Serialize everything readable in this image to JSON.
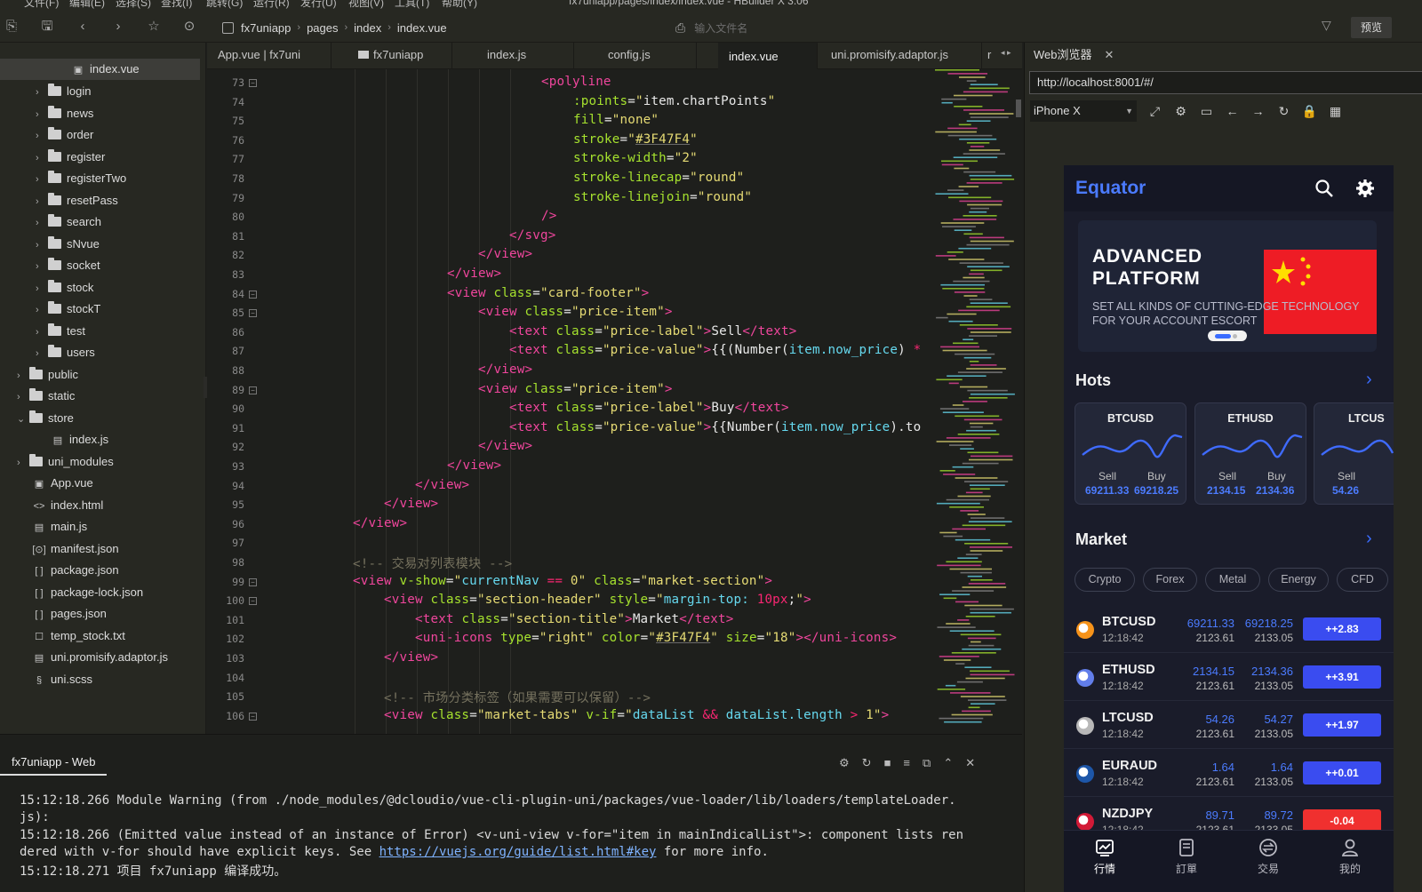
{
  "menu": [
    "文件(F)",
    "编辑(E)",
    "选择(S)",
    "查找(I)",
    "跳转(G)",
    "运行(R)",
    "发行(U)",
    "视图(V)",
    "工具(T)",
    "帮助(Y)"
  ],
  "window_title": "fx7uniapp/pages/index/index.vue - HBuilder X 3.06",
  "breadcrumb": [
    "fx7uniapp",
    "pages",
    "index",
    "index.vue"
  ],
  "file_search_placeholder": "输入文件名",
  "preview_label": "预览",
  "tree": {
    "selected": "index.vue",
    "items": [
      "login",
      "news",
      "order",
      "register",
      "registerTwo",
      "resetPass",
      "search",
      "sNvue",
      "socket",
      "stock",
      "stockT",
      "test",
      "users",
      "public",
      "static",
      "store",
      "index.js",
      "uni_modules",
      "App.vue",
      "index.html",
      "main.js",
      "manifest.json",
      "package.json",
      "package-lock.json",
      "pages.json",
      "temp_stock.txt",
      "uni.promisify.adaptor.js",
      "uni.scss"
    ]
  },
  "editor_tabs": [
    "App.vue | fx7uni",
    "fx7uniapp",
    "index.js",
    "config.js",
    "index.vue",
    "uni.promisify.adaptor.js",
    "r"
  ],
  "line_numbers": [
    "73",
    "74",
    "75",
    "76",
    "77",
    "78",
    "79",
    "80",
    "81",
    "82",
    "83",
    "84",
    "85",
    "86",
    "87",
    "88",
    "89",
    "90",
    "91",
    "92",
    "93",
    "94",
    "95",
    "96",
    "97",
    "98",
    "99",
    "100",
    "101",
    "102",
    "103",
    "104",
    "105",
    "106"
  ],
  "console": {
    "tab": "fx7uniapp - Web",
    "lines": [
      "15:12:18.266 Module Warning (from ./node_modules/@dcloudio/vue-cli-plugin-uni/packages/vue-loader/lib/loaders/templateLoader.",
      "js):",
      "15:12:18.266 (Emitted value instead of an instance of Error) <v-uni-view v-for=\"item in mainIndicalList\">: component lists ren",
      "dered with v-for should have explicit keys. See ",
      "15:12:18.271 项目 fx7uniapp 编译成功。"
    ],
    "link": "https://vuejs.org/guide/list.html#key",
    "link_suffix": " for more info."
  },
  "browser": {
    "tab": "Web浏览器",
    "url": "http://localhost:8001/#/",
    "device": "iPhone X"
  },
  "app": {
    "logo": "Equator",
    "banner_title": "ADVANCED PLATFORM",
    "banner_sub": "SET ALL KINDS OF CUTTING-EDGE TECHNOLOGY FOR YOUR ACCOUNT ESCORT",
    "hots_title": "Hots",
    "market_title": "Market",
    "hots": [
      {
        "name": "BTCUSD",
        "sell_label": "Sell",
        "buy_label": "Buy",
        "sell": "69211.33",
        "buy": "69218.25"
      },
      {
        "name": "ETHUSD",
        "sell_label": "Sell",
        "buy_label": "Buy",
        "sell": "2134.15",
        "buy": "2134.36"
      },
      {
        "name": "LTCUS",
        "sell_label": "Sell",
        "sell": "54.26"
      }
    ],
    "market_tabs": [
      "Crypto",
      "Forex",
      "Metal",
      "Energy",
      "CFD"
    ],
    "market_rows": [
      {
        "sym": "BTCUSD",
        "time": "12:18:42",
        "sell": "69211.33",
        "buy": "69218.25",
        "low": "2123.61",
        "high": "2133.05",
        "change": "++2.83",
        "up": true
      },
      {
        "sym": "ETHUSD",
        "time": "12:18:42",
        "sell": "2134.15",
        "buy": "2134.36",
        "low": "2123.61",
        "high": "2133.05",
        "change": "++3.91",
        "up": true
      },
      {
        "sym": "LTCUSD",
        "time": "12:18:42",
        "sell": "54.26",
        "buy": "54.27",
        "low": "2123.61",
        "high": "2133.05",
        "change": "++1.97",
        "up": true
      },
      {
        "sym": "EURAUD",
        "time": "12:18:42",
        "sell": "1.64",
        "buy": "1.64",
        "low": "2123.61",
        "high": "2133.05",
        "change": "++0.01",
        "up": true
      },
      {
        "sym": "NZDJPY",
        "time": "12:18:42",
        "sell": "89.71",
        "buy": "89.72",
        "low": "2123.61",
        "high": "2133.05",
        "change": "-0.04",
        "up": false
      }
    ],
    "nav": [
      "行情",
      "訂單",
      "交易",
      "我的"
    ]
  },
  "colors": {
    "accent": "#3F47F4",
    "up": "#3a4cf0",
    "down": "#f0302f",
    "brand": "#4b7bff"
  }
}
